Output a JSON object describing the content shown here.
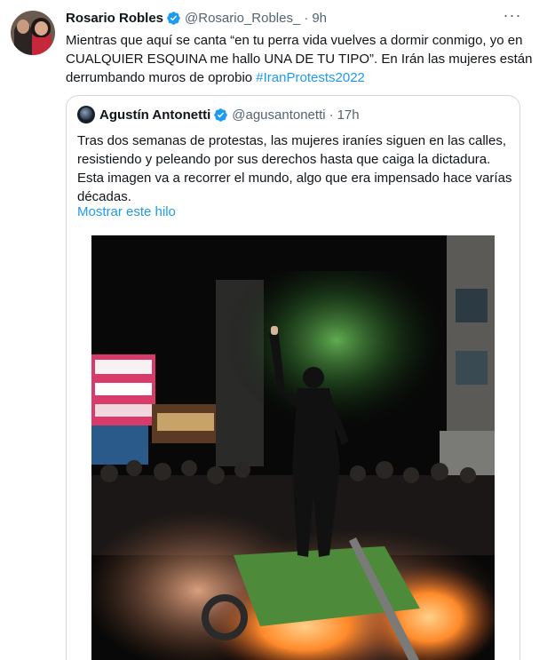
{
  "tweet": {
    "author_name": "Rosario Robles",
    "handle": "@Rosario_Robles_",
    "separator": "·",
    "time": "9h",
    "more_label": "···",
    "text_part1": "Mientras que aquí se canta “en tu perra vida vuelves a dormir conmigo, yo en CUALQUIER ESQUINA me hallo UNA DE TU TIPO”. En Irán las mujeres están derrumbando muros de oprobio ",
    "hashtag": "#IranProtests2022"
  },
  "quoted": {
    "author_name": "Agustín Antonetti",
    "handle": "@agusantonetti",
    "separator": "·",
    "time": "17h",
    "text": "Tras dos semanas de protestas, las mujeres iraníes siguen en las calles, resistiendo y peleando por sus derechos hasta que caiga la dictadura. Esta imagen va a recorrer el mundo, algo que era impensado hace varías décadas.",
    "show_thread": "Mostrar este hilo"
  },
  "icons": {
    "verified": "verified-badge-icon",
    "more": "more-options-icon"
  },
  "colors": {
    "link": "#1d9bf0",
    "secondary_text": "#536471",
    "primary_text": "#0f1419",
    "border": "#cfd9de"
  }
}
